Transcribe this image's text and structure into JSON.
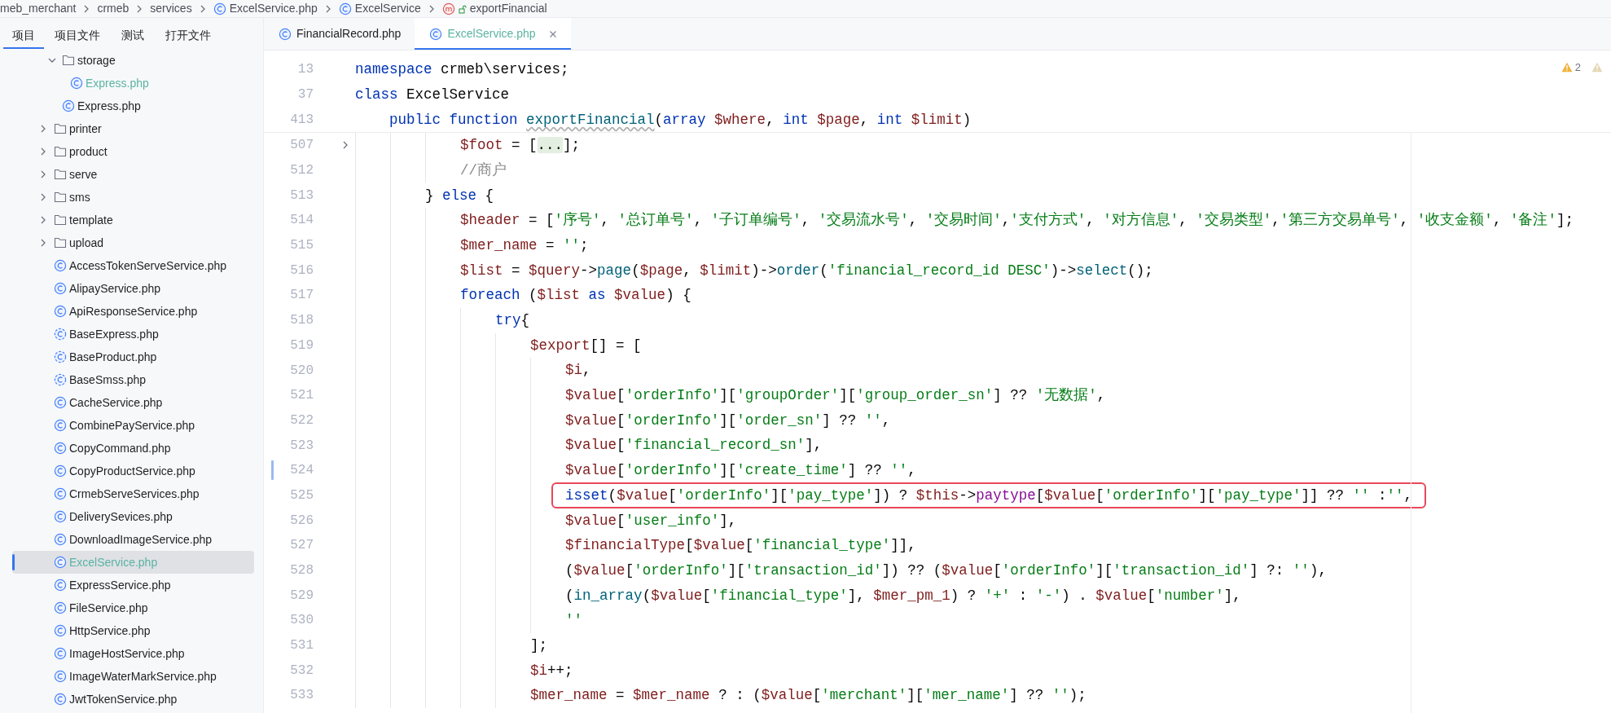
{
  "breadcrumbs": [
    {
      "kind": "folder",
      "label": "meb_merchant"
    },
    {
      "kind": "folder",
      "label": "crmeb"
    },
    {
      "kind": "folder",
      "label": "services"
    },
    {
      "kind": "file",
      "label": "ExcelService.php"
    },
    {
      "kind": "class",
      "label": "ExcelService"
    },
    {
      "kind": "method",
      "label": "exportFinancial"
    }
  ],
  "tool_window_tabs": [
    {
      "label": "项目",
      "selected": true
    },
    {
      "label": "项目文件",
      "selected": false
    },
    {
      "label": "测试",
      "selected": false
    },
    {
      "label": "打开文件",
      "selected": false
    }
  ],
  "project_tree": [
    {
      "kind": "continuation",
      "children": [
        {
          "kind": "folder",
          "name": "storage",
          "expanded": true,
          "selected": false,
          "changed": false,
          "children": [
            {
              "kind": "class",
              "name": "Express.php",
              "selected": false,
              "changed": true
            }
          ]
        },
        {
          "kind": "class",
          "name": "Express.php",
          "selected": false,
          "changed": false
        }
      ]
    },
    {
      "kind": "folder",
      "name": "printer",
      "expanded": false,
      "selected": false,
      "changed": false
    },
    {
      "kind": "folder",
      "name": "product",
      "expanded": false,
      "selected": false,
      "changed": false
    },
    {
      "kind": "folder",
      "name": "serve",
      "expanded": false,
      "selected": false,
      "changed": false
    },
    {
      "kind": "folder",
      "name": "sms",
      "expanded": false,
      "selected": false,
      "changed": false
    },
    {
      "kind": "folder",
      "name": "template",
      "expanded": false,
      "selected": false,
      "changed": false
    },
    {
      "kind": "folder",
      "name": "upload",
      "expanded": false,
      "selected": false,
      "changed": false
    },
    {
      "kind": "class",
      "name": "AccessTokenServeService.php",
      "selected": false,
      "changed": false
    },
    {
      "kind": "class",
      "name": "AlipayService.php",
      "selected": false,
      "changed": false
    },
    {
      "kind": "class",
      "name": "ApiResponseService.php",
      "selected": false,
      "changed": false
    },
    {
      "kind": "abstract",
      "name": "BaseExpress.php",
      "selected": false,
      "changed": false
    },
    {
      "kind": "abstract",
      "name": "BaseProduct.php",
      "selected": false,
      "changed": false
    },
    {
      "kind": "abstract",
      "name": "BaseSmss.php",
      "selected": false,
      "changed": false
    },
    {
      "kind": "class",
      "name": "CacheService.php",
      "selected": false,
      "changed": false
    },
    {
      "kind": "class",
      "name": "CombinePayService.php",
      "selected": false,
      "changed": false
    },
    {
      "kind": "class",
      "name": "CopyCommand.php",
      "selected": false,
      "changed": false
    },
    {
      "kind": "class",
      "name": "CopyProductService.php",
      "selected": false,
      "changed": false
    },
    {
      "kind": "class",
      "name": "CrmebServeServices.php",
      "selected": false,
      "changed": false
    },
    {
      "kind": "class",
      "name": "DeliverySevices.php",
      "selected": false,
      "changed": false
    },
    {
      "kind": "class",
      "name": "DownloadImageService.php",
      "selected": false,
      "changed": false
    },
    {
      "kind": "class",
      "name": "ExcelService.php",
      "selected": true,
      "changed": true
    },
    {
      "kind": "class",
      "name": "ExpressService.php",
      "selected": false,
      "changed": false
    },
    {
      "kind": "class",
      "name": "FileService.php",
      "selected": false,
      "changed": false
    },
    {
      "kind": "class",
      "name": "HttpService.php",
      "selected": false,
      "changed": false
    },
    {
      "kind": "class",
      "name": "ImageHostService.php",
      "selected": false,
      "changed": false
    },
    {
      "kind": "class",
      "name": "ImageWaterMarkService.php",
      "selected": false,
      "changed": false
    },
    {
      "kind": "class",
      "name": "JwtTokenService.php",
      "selected": false,
      "changed": false
    }
  ],
  "editor_tabs": [
    {
      "label": "FinancialRecord.php",
      "selected": false,
      "changed": false,
      "closable": false
    },
    {
      "label": "ExcelService.php",
      "selected": true,
      "changed": true,
      "closable": true
    }
  ],
  "inspections": {
    "warning_count": "2"
  },
  "sticky_lines": [
    {
      "number": "13",
      "tokens": [
        {
          "kind": "kw",
          "text": "namespace"
        },
        {
          "kind": "p",
          "text": " crmeb\\services;"
        }
      ]
    },
    {
      "number": "37",
      "tokens": [
        {
          "kind": "kw",
          "text": "class"
        },
        {
          "kind": "p",
          "text": " ExcelService"
        }
      ]
    },
    {
      "number": "413",
      "tokens": [
        {
          "kind": "kw",
          "text": "    public function "
        },
        {
          "kind": "fn_decl",
          "text": "exportFinancial"
        },
        {
          "kind": "p",
          "text": "("
        },
        {
          "kind": "kw",
          "text": "array "
        },
        {
          "kind": "var",
          "text": "$where"
        },
        {
          "kind": "p",
          "text": ", "
        },
        {
          "kind": "kw",
          "text": "int "
        },
        {
          "kind": "var",
          "text": "$page"
        },
        {
          "kind": "p",
          "text": ", "
        },
        {
          "kind": "kw",
          "text": "int "
        },
        {
          "kind": "var",
          "text": "$limit"
        },
        {
          "kind": "p",
          "text": ")"
        }
      ]
    }
  ],
  "lines": [
    {
      "number": "507",
      "kind": "fold",
      "boxed": false,
      "tokens": [
        {
          "kind": "var",
          "text": "            $foot"
        },
        {
          "kind": "p",
          "text": " = ["
        },
        {
          "kind": "fold",
          "text": "..."
        },
        {
          "kind": "p",
          "text": "];"
        }
      ]
    },
    {
      "number": "512",
      "kind": "plain",
      "boxed": false,
      "tokens": [
        {
          "kind": "cmt",
          "text": "            //商户"
        }
      ]
    },
    {
      "number": "513",
      "kind": "plain",
      "boxed": false,
      "tokens": [
        {
          "kind": "p",
          "text": "        } "
        },
        {
          "kind": "kw",
          "text": "else"
        },
        {
          "kind": "p",
          "text": " {"
        }
      ]
    },
    {
      "number": "514",
      "kind": "plain",
      "boxed": false,
      "tokens": [
        {
          "kind": "var",
          "text": "            $header"
        },
        {
          "kind": "p",
          "text": " = ["
        },
        {
          "kind": "str",
          "text": "'序号'"
        },
        {
          "kind": "p",
          "text": ", "
        },
        {
          "kind": "str",
          "text": "'总订单号'"
        },
        {
          "kind": "p",
          "text": ", "
        },
        {
          "kind": "str",
          "text": "'子订单编号'"
        },
        {
          "kind": "p",
          "text": ", "
        },
        {
          "kind": "str",
          "text": "'交易流水号'"
        },
        {
          "kind": "p",
          "text": ", "
        },
        {
          "kind": "str",
          "text": "'交易时间'"
        },
        {
          "kind": "p",
          "text": ","
        },
        {
          "kind": "str",
          "text": "'支付方式'"
        },
        {
          "kind": "p",
          "text": ", "
        },
        {
          "kind": "str",
          "text": "'对方信息'"
        },
        {
          "kind": "p",
          "text": ", "
        },
        {
          "kind": "str",
          "text": "'交易类型'"
        },
        {
          "kind": "p",
          "text": ","
        },
        {
          "kind": "str",
          "text": "'第三方交易单号'"
        },
        {
          "kind": "p",
          "text": ", "
        },
        {
          "kind": "str",
          "text": "'收支金额'"
        },
        {
          "kind": "p",
          "text": ", "
        },
        {
          "kind": "str",
          "text": "'备注'"
        },
        {
          "kind": "p",
          "text": "];"
        }
      ]
    },
    {
      "number": "515",
      "kind": "plain",
      "boxed": false,
      "tokens": [
        {
          "kind": "var",
          "text": "            $mer_name"
        },
        {
          "kind": "p",
          "text": " = "
        },
        {
          "kind": "str",
          "text": "''"
        },
        {
          "kind": "p",
          "text": ";"
        }
      ]
    },
    {
      "number": "516",
      "kind": "plain",
      "boxed": false,
      "tokens": [
        {
          "kind": "var",
          "text": "            $list"
        },
        {
          "kind": "p",
          "text": " = "
        },
        {
          "kind": "var",
          "text": "$query"
        },
        {
          "kind": "p",
          "text": "->"
        },
        {
          "kind": "fn",
          "text": "page"
        },
        {
          "kind": "p",
          "text": "("
        },
        {
          "kind": "var",
          "text": "$page"
        },
        {
          "kind": "p",
          "text": ", "
        },
        {
          "kind": "var",
          "text": "$limit"
        },
        {
          "kind": "p",
          "text": ")->"
        },
        {
          "kind": "fn",
          "text": "order"
        },
        {
          "kind": "p",
          "text": "("
        },
        {
          "kind": "str",
          "text": "'financial_record_id DESC'"
        },
        {
          "kind": "p",
          "text": ")->"
        },
        {
          "kind": "fn",
          "text": "select"
        },
        {
          "kind": "p",
          "text": "();"
        }
      ]
    },
    {
      "number": "517",
      "kind": "plain",
      "boxed": false,
      "tokens": [
        {
          "kind": "kw",
          "text": "            foreach"
        },
        {
          "kind": "p",
          "text": " ("
        },
        {
          "kind": "var",
          "text": "$list "
        },
        {
          "kind": "kw",
          "text": "as "
        },
        {
          "kind": "var",
          "text": "$value"
        },
        {
          "kind": "p",
          "text": ") {"
        }
      ]
    },
    {
      "number": "518",
      "kind": "plain",
      "boxed": false,
      "tokens": [
        {
          "kind": "kw",
          "text": "                try"
        },
        {
          "kind": "p",
          "text": "{"
        }
      ]
    },
    {
      "number": "519",
      "kind": "plain",
      "boxed": false,
      "tokens": [
        {
          "kind": "var",
          "text": "                    $export"
        },
        {
          "kind": "p",
          "text": "[] = ["
        }
      ]
    },
    {
      "number": "520",
      "kind": "plain",
      "boxed": false,
      "tokens": [
        {
          "kind": "var",
          "text": "                        $i"
        },
        {
          "kind": "p",
          "text": ","
        }
      ]
    },
    {
      "number": "521",
      "kind": "plain",
      "boxed": false,
      "tokens": [
        {
          "kind": "var",
          "text": "                        $value"
        },
        {
          "kind": "p",
          "text": "["
        },
        {
          "kind": "str",
          "text": "'orderInfo'"
        },
        {
          "kind": "p",
          "text": "]["
        },
        {
          "kind": "str",
          "text": "'groupOrder'"
        },
        {
          "kind": "p",
          "text": "]["
        },
        {
          "kind": "str",
          "text": "'group_order_sn'"
        },
        {
          "kind": "p",
          "text": "] ?? "
        },
        {
          "kind": "str",
          "text": "'无数据'"
        },
        {
          "kind": "p",
          "text": ","
        }
      ]
    },
    {
      "number": "522",
      "kind": "plain",
      "boxed": false,
      "tokens": [
        {
          "kind": "var",
          "text": "                        $value"
        },
        {
          "kind": "p",
          "text": "["
        },
        {
          "kind": "str",
          "text": "'orderInfo'"
        },
        {
          "kind": "p",
          "text": "]["
        },
        {
          "kind": "str",
          "text": "'order_sn'"
        },
        {
          "kind": "p",
          "text": "] ?? "
        },
        {
          "kind": "str",
          "text": "''"
        },
        {
          "kind": "p",
          "text": ","
        }
      ]
    },
    {
      "number": "523",
      "kind": "plain",
      "boxed": false,
      "tokens": [
        {
          "kind": "var",
          "text": "                        $value"
        },
        {
          "kind": "p",
          "text": "["
        },
        {
          "kind": "str",
          "text": "'financial_record_sn'"
        },
        {
          "kind": "p",
          "text": "],"
        }
      ]
    },
    {
      "number": "524",
      "kind": "changed",
      "boxed": false,
      "tokens": [
        {
          "kind": "var",
          "text": "                        $value"
        },
        {
          "kind": "p",
          "text": "["
        },
        {
          "kind": "str",
          "text": "'orderInfo'"
        },
        {
          "kind": "p",
          "text": "]["
        },
        {
          "kind": "str",
          "text": "'create_time'"
        },
        {
          "kind": "p",
          "text": "] ?? "
        },
        {
          "kind": "str",
          "text": "''"
        },
        {
          "kind": "p",
          "text": ","
        }
      ]
    },
    {
      "number": "525",
      "kind": "plain",
      "boxed": true,
      "tokens": [
        {
          "kind": "kw",
          "text": "                        isset"
        },
        {
          "kind": "p",
          "text": "("
        },
        {
          "kind": "var",
          "text": "$value"
        },
        {
          "kind": "p",
          "text": "["
        },
        {
          "kind": "str",
          "text": "'orderInfo'"
        },
        {
          "kind": "p",
          "text": "]["
        },
        {
          "kind": "str",
          "text": "'pay_type'"
        },
        {
          "kind": "p",
          "text": "]) ? "
        },
        {
          "kind": "var",
          "text": "$this"
        },
        {
          "kind": "p",
          "text": "->"
        },
        {
          "kind": "prop",
          "text": "paytype"
        },
        {
          "kind": "p",
          "text": "["
        },
        {
          "kind": "var",
          "text": "$value"
        },
        {
          "kind": "p",
          "text": "["
        },
        {
          "kind": "str",
          "text": "'orderInfo'"
        },
        {
          "kind": "p",
          "text": "]["
        },
        {
          "kind": "str",
          "text": "'pay_type'"
        },
        {
          "kind": "p",
          "text": "]] ?? "
        },
        {
          "kind": "str",
          "text": "''"
        },
        {
          "kind": "p",
          "text": " :"
        },
        {
          "kind": "str",
          "text": "''"
        },
        {
          "kind": "p",
          "text": ","
        }
      ]
    },
    {
      "number": "526",
      "kind": "plain",
      "boxed": false,
      "tokens": [
        {
          "kind": "var",
          "text": "                        $value"
        },
        {
          "kind": "p",
          "text": "["
        },
        {
          "kind": "str",
          "text": "'user_info'"
        },
        {
          "kind": "p",
          "text": "],"
        }
      ]
    },
    {
      "number": "527",
      "kind": "plain",
      "boxed": false,
      "tokens": [
        {
          "kind": "var",
          "text": "                        $financialType"
        },
        {
          "kind": "p",
          "text": "["
        },
        {
          "kind": "var",
          "text": "$value"
        },
        {
          "kind": "p",
          "text": "["
        },
        {
          "kind": "str",
          "text": "'financial_type'"
        },
        {
          "kind": "p",
          "text": "]],"
        }
      ]
    },
    {
      "number": "528",
      "kind": "plain",
      "boxed": false,
      "tokens": [
        {
          "kind": "p",
          "text": "                        ("
        },
        {
          "kind": "var",
          "text": "$value"
        },
        {
          "kind": "p",
          "text": "["
        },
        {
          "kind": "str",
          "text": "'orderInfo'"
        },
        {
          "kind": "p",
          "text": "]["
        },
        {
          "kind": "str",
          "text": "'transaction_id'"
        },
        {
          "kind": "p",
          "text": "]) ?? ("
        },
        {
          "kind": "var",
          "text": "$value"
        },
        {
          "kind": "p",
          "text": "["
        },
        {
          "kind": "str",
          "text": "'orderInfo'"
        },
        {
          "kind": "p",
          "text": "]["
        },
        {
          "kind": "str",
          "text": "'transaction_id'"
        },
        {
          "kind": "p",
          "text": "] ?: "
        },
        {
          "kind": "str",
          "text": "''"
        },
        {
          "kind": "p",
          "text": "),"
        }
      ]
    },
    {
      "number": "529",
      "kind": "plain",
      "boxed": false,
      "tokens": [
        {
          "kind": "p",
          "text": "                        ("
        },
        {
          "kind": "fn",
          "text": "in_array"
        },
        {
          "kind": "p",
          "text": "("
        },
        {
          "kind": "var",
          "text": "$value"
        },
        {
          "kind": "p",
          "text": "["
        },
        {
          "kind": "str",
          "text": "'financial_type'"
        },
        {
          "kind": "p",
          "text": "], "
        },
        {
          "kind": "var",
          "text": "$mer_pm_1"
        },
        {
          "kind": "p",
          "text": ") ? "
        },
        {
          "kind": "str",
          "text": "'+'"
        },
        {
          "kind": "p",
          "text": " : "
        },
        {
          "kind": "str",
          "text": "'-'"
        },
        {
          "kind": "p",
          "text": ") . "
        },
        {
          "kind": "var",
          "text": "$value"
        },
        {
          "kind": "p",
          "text": "["
        },
        {
          "kind": "str",
          "text": "'number'"
        },
        {
          "kind": "p",
          "text": "],"
        }
      ]
    },
    {
      "number": "530",
      "kind": "plain",
      "boxed": false,
      "tokens": [
        {
          "kind": "str",
          "text": "                        ''"
        }
      ]
    },
    {
      "number": "531",
      "kind": "plain",
      "boxed": false,
      "tokens": [
        {
          "kind": "p",
          "text": "                    ];"
        }
      ]
    },
    {
      "number": "532",
      "kind": "plain",
      "boxed": false,
      "tokens": [
        {
          "kind": "var",
          "text": "                    $i"
        },
        {
          "kind": "p",
          "text": "++;"
        }
      ]
    },
    {
      "number": "533",
      "kind": "plain",
      "boxed": false,
      "tokens": [
        {
          "kind": "var",
          "text": "                    $mer_name"
        },
        {
          "kind": "p",
          "text": " = "
        },
        {
          "kind": "var",
          "text": "$mer_name"
        },
        {
          "kind": "p",
          "text": " ? : ("
        },
        {
          "kind": "var",
          "text": "$value"
        },
        {
          "kind": "p",
          "text": "["
        },
        {
          "kind": "str",
          "text": "'merchant'"
        },
        {
          "kind": "p",
          "text": "]["
        },
        {
          "kind": "str",
          "text": "'mer_name'"
        },
        {
          "kind": "p",
          "text": "] ?? "
        },
        {
          "kind": "str",
          "text": "''"
        },
        {
          "kind": "p",
          "text": ");"
        }
      ]
    }
  ]
}
